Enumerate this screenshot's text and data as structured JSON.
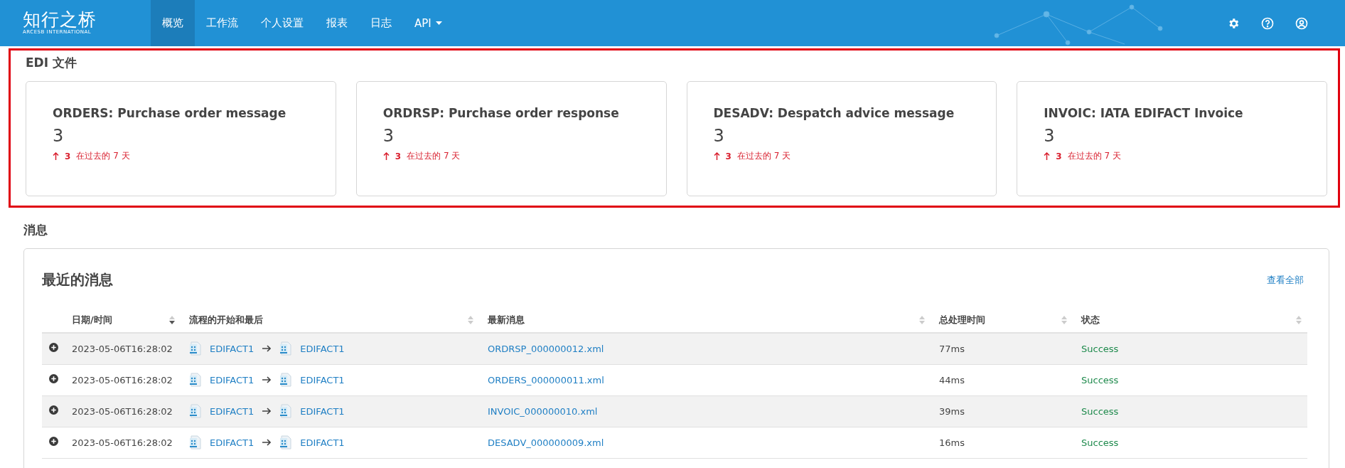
{
  "brand": {
    "name": "知行之桥",
    "tagline": "ARCESB INTERNATIONAL"
  },
  "nav": [
    {
      "label": "概览",
      "selected": true,
      "kind": "link"
    },
    {
      "label": "工作流",
      "selected": false,
      "kind": "link"
    },
    {
      "label": "个人设置",
      "selected": false,
      "kind": "link"
    },
    {
      "label": "报表",
      "selected": false,
      "kind": "link"
    },
    {
      "label": "日志",
      "selected": false,
      "kind": "link"
    },
    {
      "label": "API",
      "selected": false,
      "kind": "dropdown"
    }
  ],
  "edi_section": {
    "title": "EDI 文件",
    "highlighted": true,
    "cards": [
      {
        "title": "ORDERS: Purchase order message",
        "count": "3",
        "change": "3",
        "period": "在过去的 7 天"
      },
      {
        "title": "ORDRSP: Purchase order response",
        "count": "3",
        "change": "3",
        "period": "在过去的 7 天"
      },
      {
        "title": "DESADV: Despatch advice message",
        "count": "3",
        "change": "3",
        "period": "在过去的 7 天"
      },
      {
        "title": "INVOIC: IATA EDIFACT Invoice",
        "count": "3",
        "change": "3",
        "period": "在过去的 7 天"
      }
    ]
  },
  "messages_section": {
    "title": "消息",
    "panel_title": "最近的消息",
    "view_all": "查看全部",
    "table": {
      "columns": [
        {
          "label": "日期/时间",
          "sorted_descending": true
        },
        {
          "label": "流程的开始和最后",
          "sorted_descending": false
        },
        {
          "label": "最新消息",
          "sorted_descending": false
        },
        {
          "label": "总处理时间",
          "sorted_descending": false
        },
        {
          "label": "状态",
          "sorted_descending": false
        }
      ],
      "rows": [
        {
          "datetime": "2023-05-06T16:28:02",
          "start": "EDIFACT1",
          "end": "EDIFACT1",
          "message": "ORDRSP_000000012.xml",
          "duration": "77ms",
          "status": "Success"
        },
        {
          "datetime": "2023-05-06T16:28:02",
          "start": "EDIFACT1",
          "end": "EDIFACT1",
          "message": "ORDERS_000000011.xml",
          "duration": "44ms",
          "status": "Success"
        },
        {
          "datetime": "2023-05-06T16:28:02",
          "start": "EDIFACT1",
          "end": "EDIFACT1",
          "message": "INVOIC_000000010.xml",
          "duration": "39ms",
          "status": "Success"
        },
        {
          "datetime": "2023-05-06T16:28:02",
          "start": "EDIFACT1",
          "end": "EDIFACT1",
          "message": "DESADV_000000009.xml",
          "duration": "16ms",
          "status": "Success"
        }
      ]
    }
  }
}
